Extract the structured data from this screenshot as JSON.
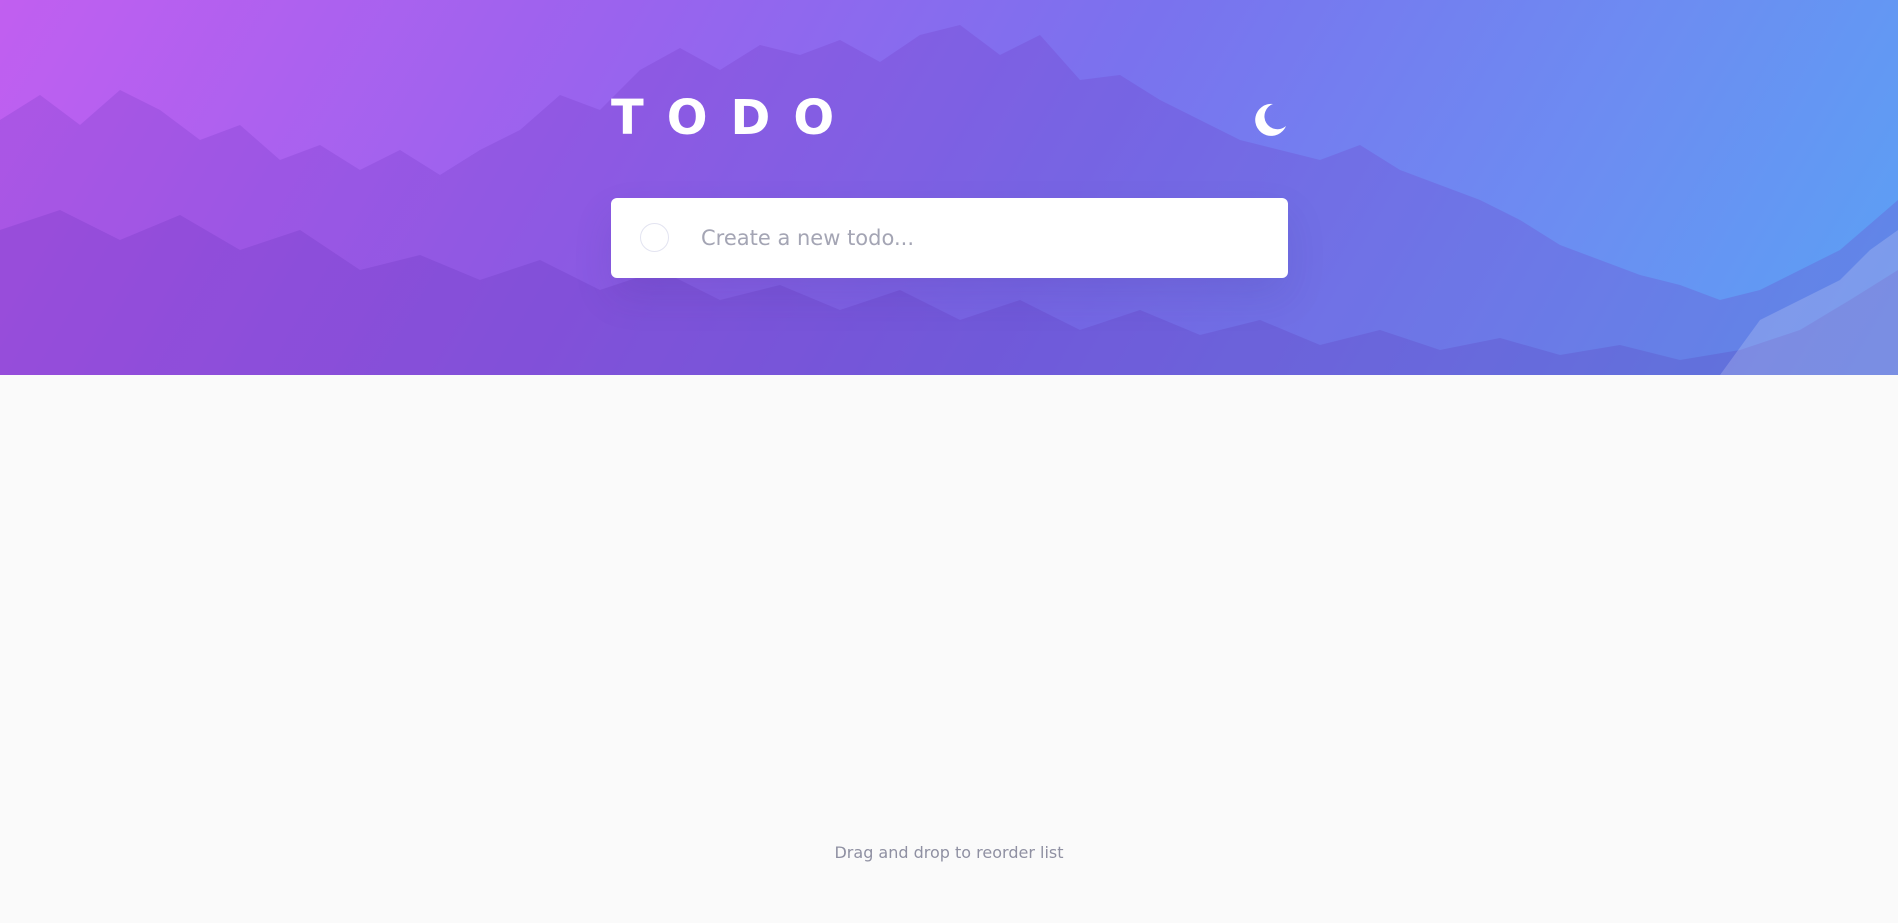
{
  "app": {
    "title": "TODO"
  },
  "theme_toggle": {
    "icon": "moon-icon"
  },
  "new_todo": {
    "placeholder": "Create a new todo..."
  },
  "footer": {
    "hint": "Drag and drop to reorder list"
  },
  "colors": {
    "page_background": "#fafafa",
    "gradient_start": "#c15ff0",
    "gradient_end": "#5aa2f4",
    "card_background": "#ffffff",
    "placeholder_text": "#a4a5b4",
    "hint_text": "#8f90a2"
  }
}
